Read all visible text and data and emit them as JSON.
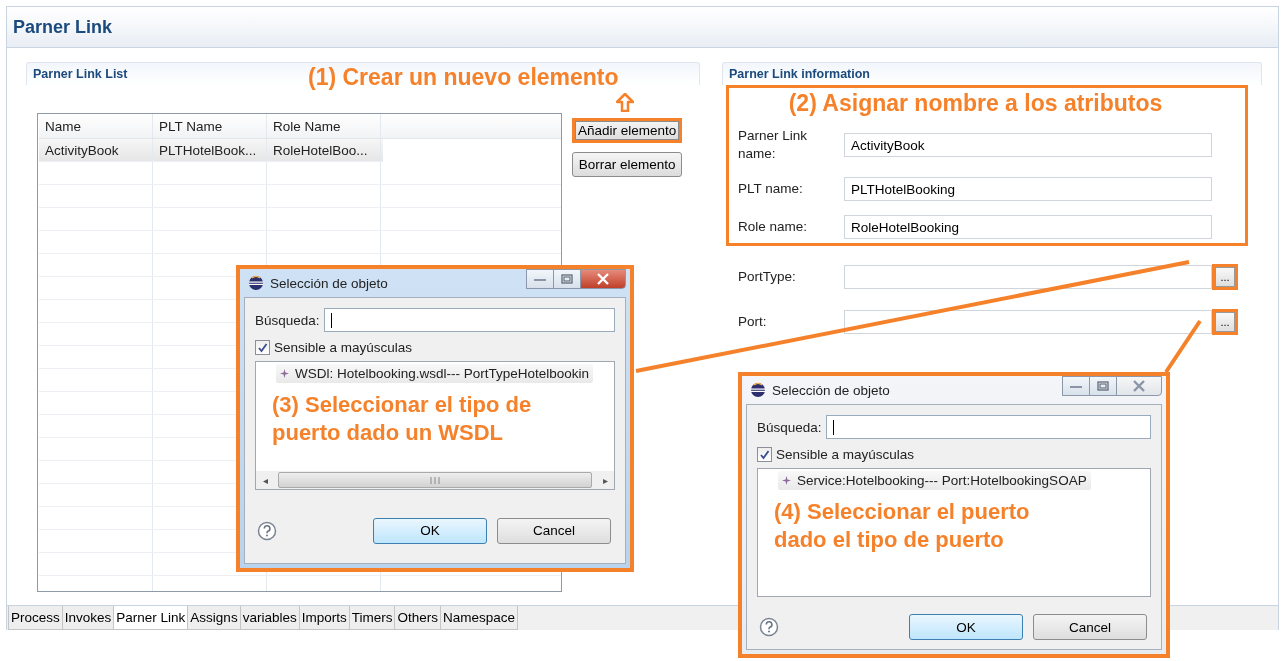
{
  "page_title": "Parner Link",
  "list_section": {
    "title": "Parner Link List",
    "annotation": "(1) Crear un nuevo elemento",
    "table": {
      "columns": [
        "Name",
        "PLT Name",
        "Role Name"
      ],
      "rows": [
        {
          "cells": [
            "ActivityBook",
            "PLTHotelBook...",
            "RoleHotelBoo..."
          ],
          "selected": true
        }
      ]
    },
    "buttons": [
      {
        "label": "Añadir elemento",
        "highlighted": true
      },
      {
        "label": "Borrar elemento",
        "highlighted": false
      }
    ]
  },
  "info_section": {
    "title": "Parner Link information",
    "annotation": "(2) Asignar nombre a los atributos",
    "fields": [
      {
        "label": "Parner Link name:",
        "value": "ActivityBook"
      },
      {
        "label": "PLT name:",
        "value": "PLTHotelBooking"
      },
      {
        "label": "Role name:",
        "value": "RoleHotelBooking"
      }
    ],
    "browse_fields": [
      {
        "label": "PortType:",
        "button": "..."
      },
      {
        "label": "Port:",
        "button": "..."
      }
    ]
  },
  "tabs": [
    {
      "label": "Process",
      "selected": false
    },
    {
      "label": "Invokes",
      "selected": false
    },
    {
      "label": "Parner Link",
      "selected": true
    },
    {
      "label": "Assigns",
      "selected": false
    },
    {
      "label": "variables",
      "selected": false
    },
    {
      "label": "Imports",
      "selected": false
    },
    {
      "label": "Timers",
      "selected": false
    },
    {
      "label": "Others",
      "selected": false
    },
    {
      "label": "Namespace",
      "selected": false
    }
  ],
  "dialogs": [
    {
      "title": "Selección de objeto",
      "active": true,
      "search_label": "Búsqueda:",
      "checkbox": {
        "label": "Sensible a mayúsculas",
        "checked": true
      },
      "items": [
        "WSDl: Hotelbooking.wsdl--- PortTypeHotelbookin"
      ],
      "annotation": "(3) Seleccionar el tipo de puerto dado un WSDL",
      "scroll_arrow_left": "◂",
      "scroll_arrow_right": "▸",
      "buttons": [
        "OK",
        "Cancel"
      ]
    },
    {
      "title": "Selección de objeto",
      "active": false,
      "search_label": "Búsqueda:",
      "checkbox": {
        "label": "Sensible a mayúsculas",
        "checked": true
      },
      "items": [
        "Service:Hotelbooking--- Port:HotelbookingSOAP"
      ],
      "annotation": "(4) Seleccionar el puerto dado el tipo de puerto",
      "buttons": [
        "OK",
        "Cancel"
      ]
    }
  ]
}
